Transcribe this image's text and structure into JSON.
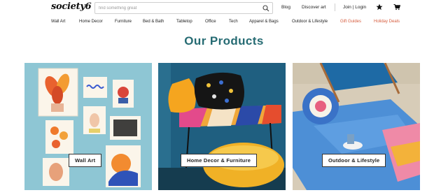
{
  "header": {
    "logo": "society6",
    "search_placeholder": "find something great",
    "links": {
      "blog": "Blog",
      "discover": "Discover art",
      "join_login": "Join | Login"
    }
  },
  "nav": {
    "items": [
      "Wall Art",
      "Home Decor",
      "Furniture",
      "Bed & Bath",
      "Tabletop",
      "Office",
      "Tech",
      "Apparel & Bags",
      "Outdoor & Lifestyle"
    ],
    "accent_items": [
      "Gift Guides",
      "Holiday Deals"
    ]
  },
  "main": {
    "title": "Our Products",
    "products": [
      {
        "label": "Wall Art"
      },
      {
        "label": "Home Decor & Furniture"
      },
      {
        "label": "Outdoor & Lifestyle"
      }
    ]
  },
  "colors": {
    "title": "#266b73",
    "accent_nav": "#d65b3c",
    "wall_bg": "#8ec6d4",
    "decor_wall": "#1f5f80",
    "sand": "#d7ccb8"
  },
  "icons": {
    "search": "search-icon",
    "favorites": "star-icon",
    "cart": "cart-icon"
  }
}
